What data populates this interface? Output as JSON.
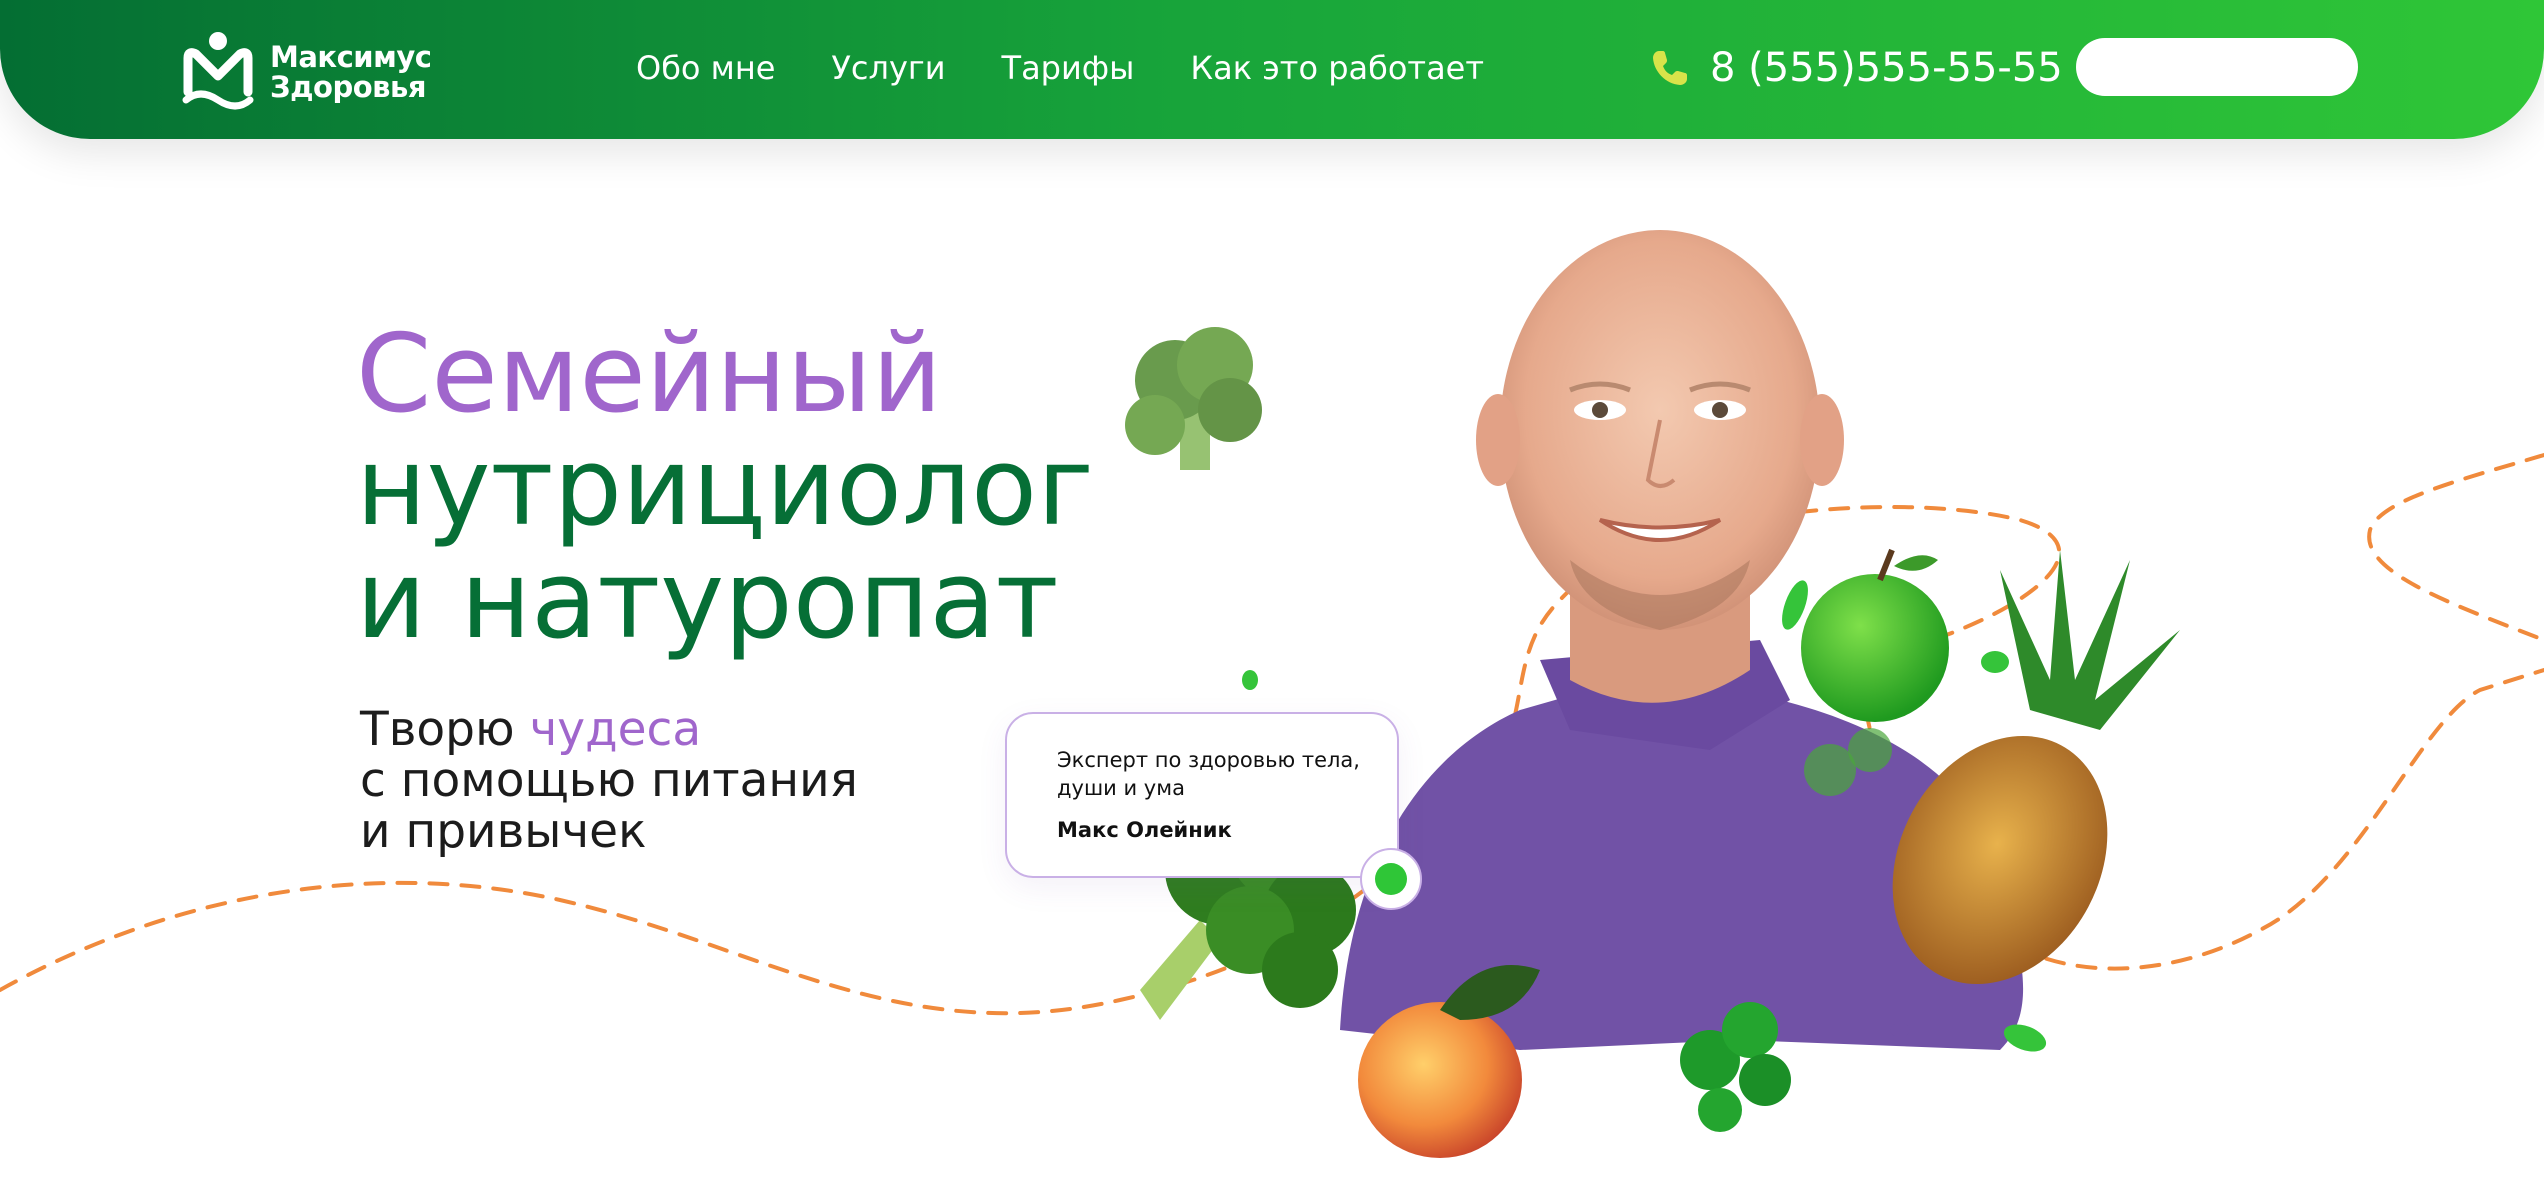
{
  "brand": {
    "name_line1": "Максимус",
    "name_line2": "Здоровья",
    "logo_icon": "m-person-logo-icon",
    "color": "#ffffff"
  },
  "nav": {
    "items": [
      {
        "label": "Обо мне"
      },
      {
        "label": "Услуги"
      },
      {
        "label": "Тарифы"
      },
      {
        "label": "Как это работает"
      }
    ]
  },
  "contact": {
    "phone_icon": "phone-icon",
    "phone_icon_color": "#d8e34a",
    "phone": "8 (555)555-55-55"
  },
  "header_input": {
    "value": "",
    "placeholder": ""
  },
  "hero": {
    "title_line1": "Семейный",
    "title_line2": "нутрициолог",
    "title_line3": "и натуропат",
    "subtitle_prefix": "Творю ",
    "subtitle_accent": "чудеса",
    "subtitle_line2": "с помощью питания",
    "subtitle_line3": "и привычек"
  },
  "quote": {
    "text": "Эксперт по здоровью тела, души и ума",
    "author": "Макс Олейник"
  },
  "colors": {
    "header_gradient_start": "#046e33",
    "header_gradient_end": "#2fc637",
    "accent_purple": "#a066cc",
    "title_green": "#066f36",
    "wave_orange": "#f08a3c",
    "sweater_purple": "#7152a6"
  }
}
